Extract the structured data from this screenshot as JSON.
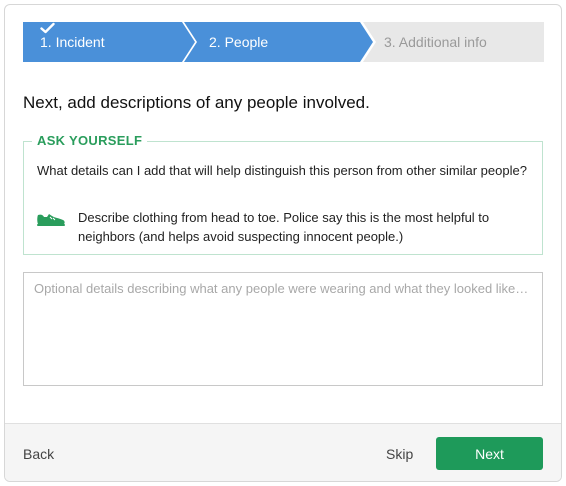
{
  "stepper": {
    "steps": [
      {
        "label": "1. Incident",
        "state": "completed"
      },
      {
        "label": "2. People",
        "state": "current"
      },
      {
        "label": "3. Additional info",
        "state": "upcoming"
      }
    ]
  },
  "heading": "Next, add descriptions of any people involved.",
  "ask": {
    "legend": "ASK YOURSELF",
    "question": "What details can I add that will help distinguish this person from other similar people?",
    "tip_icon": "sneaker-icon",
    "tip": "Describe clothing from head to toe. Police say this is the most helpful to neighbors (and helps avoid suspecting innocent people.)"
  },
  "details_field": {
    "value": "",
    "placeholder": "Optional details describing what any people were wearing and what they looked like…"
  },
  "footer": {
    "back_label": "Back",
    "skip_label": "Skip",
    "next_label": "Next"
  },
  "colors": {
    "step_active": "#4a90d9",
    "step_inactive": "#e8e8e8",
    "accent_green": "#1e9a5a",
    "ask_border": "#bfe3cf"
  }
}
